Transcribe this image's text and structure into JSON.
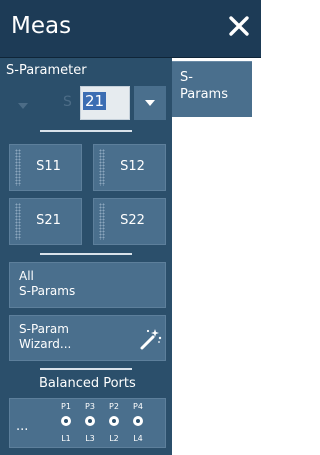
{
  "header": {
    "title": "Meas"
  },
  "side_tab": {
    "line1": "S-",
    "line2": "Params"
  },
  "s_parameter": {
    "label": "S-Parameter",
    "prefix": "S",
    "value": "21"
  },
  "grid_buttons": [
    "S11",
    "S12",
    "S21",
    "S22"
  ],
  "all_sparams": {
    "line1": "All",
    "line2": "S-Params"
  },
  "wizard": {
    "line1": "S-Param",
    "line2": "Wizard..."
  },
  "balanced_ports": {
    "label": "Balanced Ports",
    "button_label": "...",
    "top_labels": [
      "P1",
      "P3",
      "P2",
      "P4"
    ],
    "bottom_labels": [
      "L1",
      "L3",
      "L2",
      "L4"
    ]
  },
  "colors": {
    "header_bg": "#1d3b56",
    "panel_bg": "#2b4f6b",
    "button_bg": "#4a6f8d",
    "selection": "#3b6db3"
  }
}
